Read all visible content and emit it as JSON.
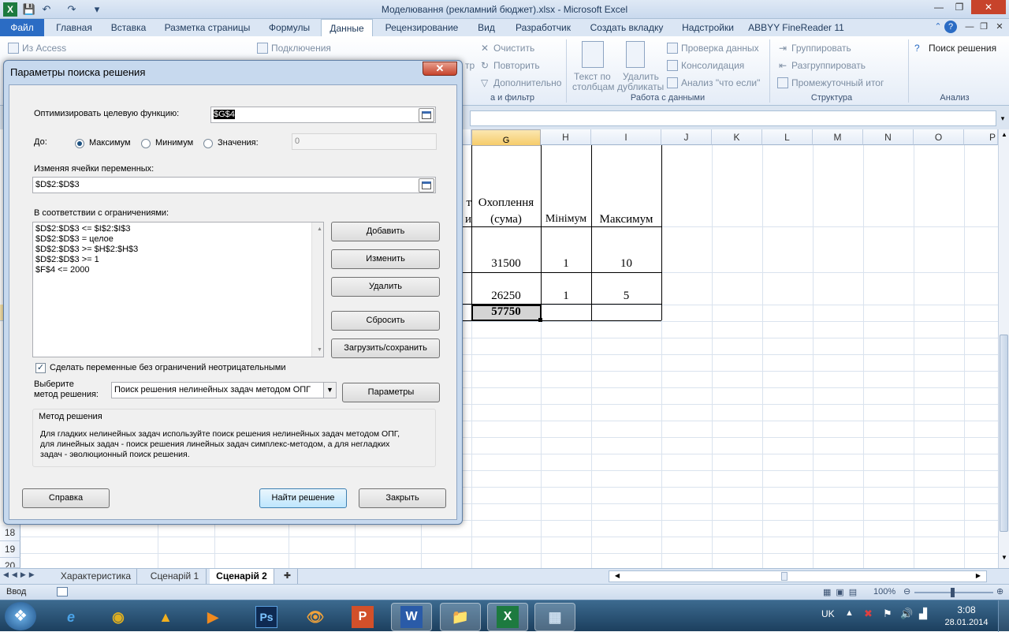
{
  "window": {
    "title": "Моделювання (рекламний бюджет).xlsx  -  Microsoft Excel",
    "minimize": "—",
    "maximize": "❐",
    "close": "✕"
  },
  "qat": {
    "save": "💾",
    "undo": "↶",
    "redo": "↷",
    "customize": "▾"
  },
  "ribbon_tabs": {
    "file": "Файл",
    "home": "Главная",
    "insert": "Вставка",
    "page_layout": "Разметка страницы",
    "formulas": "Формулы",
    "data": "Данные",
    "review": "Рецензирование",
    "view": "Вид",
    "developer": "Разработчик",
    "create_tab": "Создать вкладку",
    "addins": "Надстройки",
    "abbyy": "ABBYY FineReader 11"
  },
  "ribbon": {
    "from_access": "Из Access",
    "connections": "Подключения",
    "clear": "Очистить",
    "reapply": "Повторить",
    "advanced": "Дополнительно",
    "sort_filter_group": "а и фильтр",
    "sort_filter_prefix": "тр",
    "text_to_columns_1": "Текст по",
    "text_to_columns_2": "столбцам",
    "remove_duplicates_1": "Удалить",
    "remove_duplicates_2": "дубликаты",
    "data_validation": "Проверка данных",
    "consolidate": "Консолидация",
    "what_if": "Анализ \"что если\"",
    "data_tools_group": "Работа с данными",
    "group": "Группировать",
    "ungroup": "Разгруппировать",
    "subtotal": "Промежуточный итог",
    "outline_group": "Структура",
    "solver": "Поиск решения",
    "analysis_group": "Анализ"
  },
  "columns": [
    "G",
    "H",
    "I",
    "J",
    "K",
    "L",
    "M",
    "N",
    "O",
    "P"
  ],
  "rows": {
    "r18": "18",
    "r19": "19",
    "r20": "20"
  },
  "cells": {
    "partial_top": "т",
    "partial_bottom": "и",
    "g_header_1": "Охоплення",
    "g_header_2": "(сума)",
    "h_header": "Мінімум",
    "i_header": "Максимум",
    "g2": "31500",
    "h2": "1",
    "i2": "10",
    "g3": "26250",
    "h3": "1",
    "i3": "5",
    "g4": "57750"
  },
  "sheet_tabs": {
    "tab1": "Характеристика",
    "tab2": "Сценарій 1",
    "tab3": "Сценарій 2"
  },
  "status": {
    "mode": "Ввод",
    "zoom": "100%"
  },
  "taskbar": {
    "lang": "UK",
    "time": "3:08",
    "date": "28.01.2014",
    "start": "❖",
    "ie": "e",
    "chrome": "◉",
    "arc": "▲",
    "media": "▶",
    "photoshop": "Ps",
    "eye": "👁",
    "powerpoint": "P",
    "word": "W",
    "explorer": "📁",
    "excel": "X",
    "calc": "▦"
  },
  "dialog": {
    "title": "Параметры поиска решения",
    "close": "✕",
    "objective_label": "Оптимизировать целевую функцию:",
    "objective_value": "$G$4",
    "to_label": "До:",
    "max_label": "Максимум",
    "min_label": "Минимум",
    "value_of_label": "Значения:",
    "value_of_value": "0",
    "changing_label": "Изменяя ячейки переменных:",
    "changing_value": "$D$2:$D$3",
    "constraints_label": "В соответствии с ограничениями:",
    "constraints": [
      "$D$2:$D$3 <= $I$2:$I$3",
      "$D$2:$D$3 = целое",
      "$D$2:$D$3 >= $H$2:$H$3",
      "$D$2:$D$3 >= 1",
      "$F$4 <= 2000"
    ],
    "add": "Добавить",
    "change": "Изменить",
    "delete": "Удалить",
    "reset": "Сбросить",
    "load_save": "Загрузить/сохранить",
    "nonneg_label": "Сделать переменные без ограничений неотрицательными",
    "method_label_1": "Выберите",
    "method_label_2": "метод решения:",
    "method_value": "Поиск решения нелинейных задач методом ОПГ",
    "options": "Параметры",
    "method_group": "Метод решения",
    "method_desc_1": "Для гладких нелинейных задач используйте поиск решения нелинейных задач методом ОПГ,",
    "method_desc_2": "для линейных задач - поиск решения линейных задач симплекс-методом, а для негладких",
    "method_desc_3": "задач - эволюционный поиск решения.",
    "help": "Справка",
    "solve": "Найти решение",
    "close_btn": "Закрыть"
  }
}
